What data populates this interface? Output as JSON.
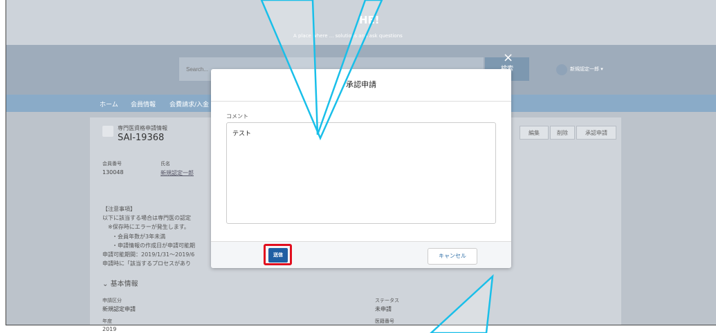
{
  "header": {
    "title": "HE!",
    "subtitle": "A place where ... solutions and ask questions"
  },
  "search": {
    "placeholder": "Search...",
    "button": "検索"
  },
  "user": {
    "name": "新規認定一郎 ▾"
  },
  "nav": {
    "items": [
      "ホーム",
      "会員情報",
      "会費請求/入金"
    ]
  },
  "record": {
    "type": "専門医資格申請情報",
    "id": "SAI-19368",
    "buttons": [
      "編集",
      "削除",
      "承認申請"
    ],
    "fields": {
      "member_no_label": "会員番号",
      "member_no": "130048",
      "name_label": "氏名",
      "name": "新規認定一郎"
    },
    "notes": [
      "【注意事項】",
      "以下に該当する場合は専門医の認定",
      "※保存時にエラーが発生します。",
      "・会員年数が3年未満",
      "・申請情報の作成日が申請可能期",
      "申請可能期間：2019/1/31～2019/6",
      "申請時に「該当するプロセスがあり"
    ],
    "section": "基本情報",
    "details": {
      "apply_type_label": "申請区分",
      "apply_type": "新規認定申請",
      "status_label": "ステータス",
      "status": "未申請",
      "year_label": "年度",
      "year": "2019",
      "doctor_no_label": "医籍番号"
    }
  },
  "modal": {
    "title": "承認申請",
    "comment_label": "コメント",
    "comment_value": "テスト",
    "cancel": "キャンセル",
    "submit": "送信",
    "close_icon": "×"
  },
  "annotation": {
    "arrow_color": "#19bfe9",
    "highlight_color": "#e10e1e"
  }
}
